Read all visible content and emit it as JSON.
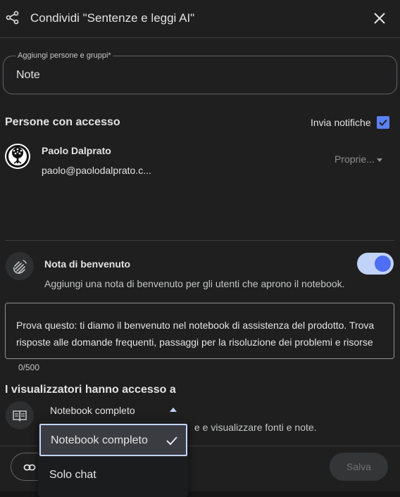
{
  "header": {
    "title": "Condividi \"Sentenze e leggi AI\""
  },
  "add_people": {
    "label": "Aggiungi persone e gruppi*",
    "value": "Note"
  },
  "access_section": {
    "title": "Persone con accesso",
    "notify_label": "Invia notifiche",
    "notify_checked": true,
    "people": [
      {
        "name": "Paolo Dalprato",
        "email": "paolo@paolodalprato.c...",
        "role": "Proprie..."
      }
    ]
  },
  "welcome": {
    "title": "Nota di benvenuto",
    "description": "Aggiungi una nota di benvenuto per gli utenti che aprono il notebook.",
    "enabled": true,
    "text": "Prova questo: ti diamo il benvenuto nel notebook di assistenza del prodotto. Trova risposte alle domande frequenti, passaggi per la risoluzione dei problemi e risorse",
    "counter": "0/500"
  },
  "viewers": {
    "title": "I visualizzatori hanno accesso a",
    "selected": "Notebook completo",
    "description": "e e visualizzare fonti e note."
  },
  "dropdown": {
    "options": [
      "Notebook completo",
      "Solo chat"
    ],
    "selected_index": 0
  },
  "footer": {
    "save_label": "Salva"
  },
  "colors": {
    "accent": "#4d6ef5",
    "background": "#1f1f1f",
    "toggle_track": "#c2d3fa"
  }
}
